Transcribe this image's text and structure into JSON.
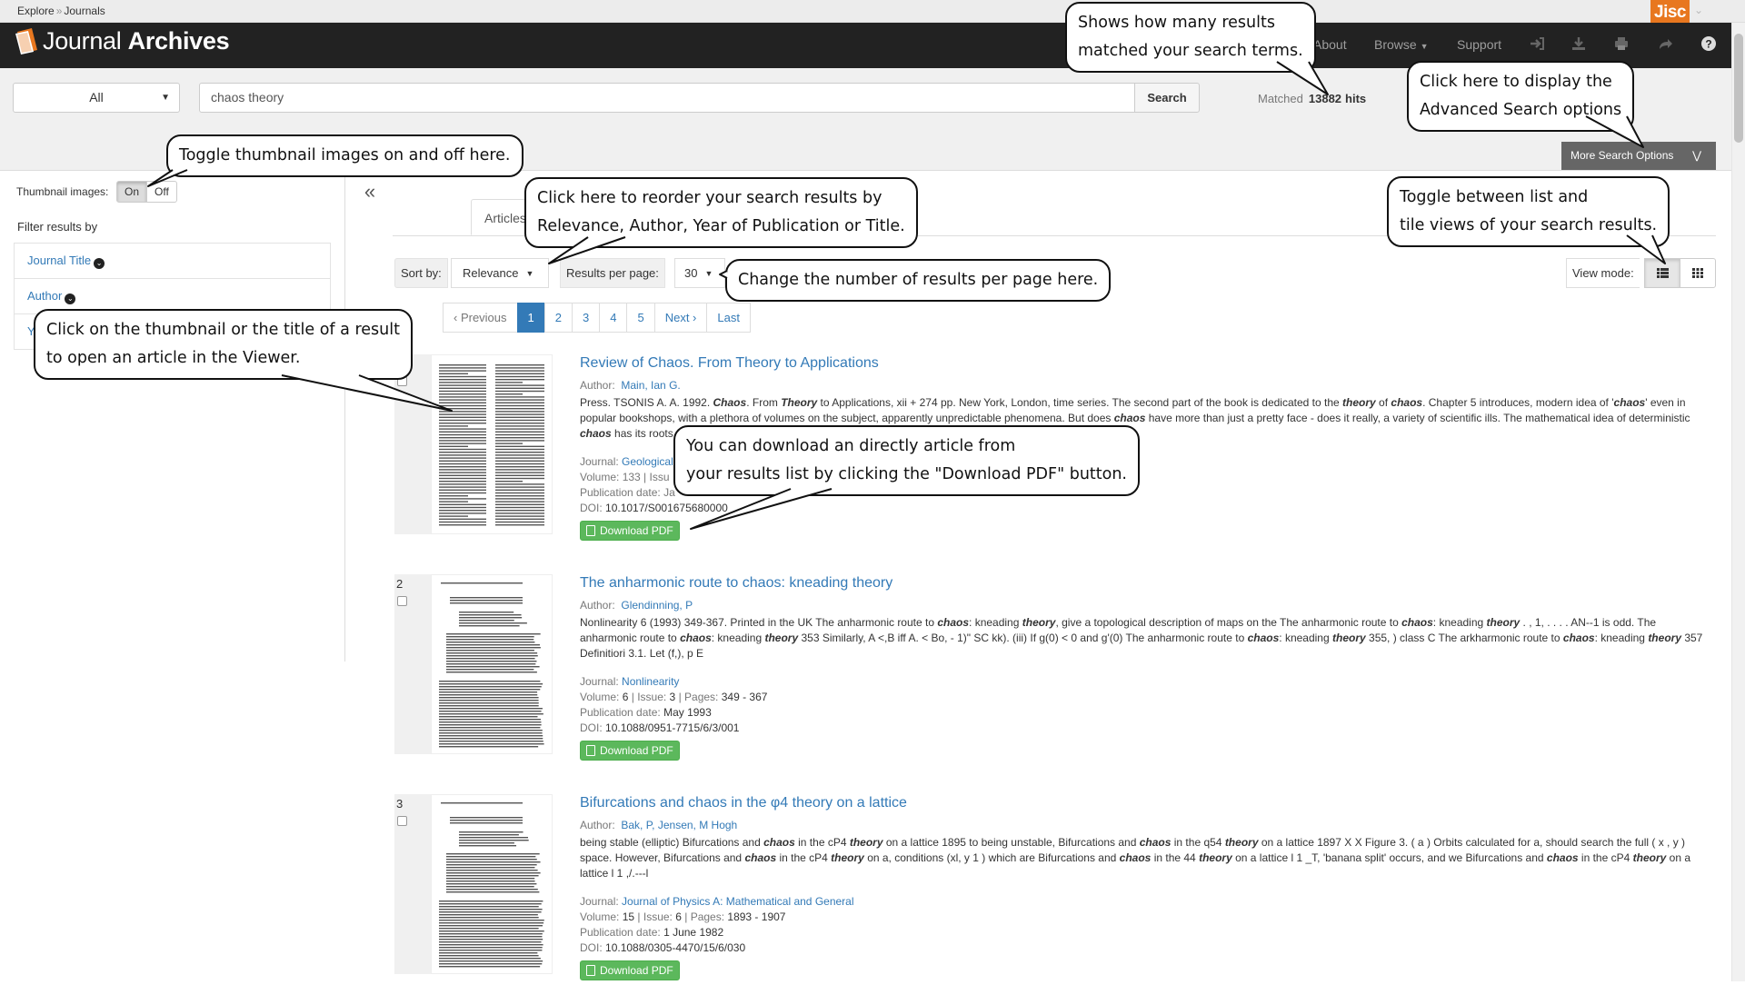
{
  "breadcrumb": {
    "explore": "Explore",
    "sep": "»",
    "journals": "Journals"
  },
  "brand": {
    "light": "Journal ",
    "bold": "Archives",
    "jisc": "Jisc"
  },
  "nav": {
    "about": "About",
    "browse": "Browse",
    "support": "Support"
  },
  "nav_icons": [
    "sign-in-icon",
    "download-icon",
    "print-icon",
    "share-icon",
    "help-icon"
  ],
  "search": {
    "scope": "All",
    "query": "chaos theory",
    "button": "Search",
    "matched_label": "Matched",
    "hit_count": "13882",
    "hits_label": "hits",
    "more_options": "More Search Options"
  },
  "sidebar": {
    "thumb_label": "Thumbnail images:",
    "on": "On",
    "off": "Off",
    "filter_title": "Filter results by",
    "facets": [
      "Journal Title",
      "Author",
      "Y"
    ]
  },
  "tabs": {
    "articles": "Articles"
  },
  "toolbar": {
    "sort_label": "Sort by:",
    "sort_value": "Relevance",
    "rpp_label": "Results per page:",
    "rpp_value": "30",
    "view_label": "View mode:"
  },
  "pager": [
    "‹ Previous",
    "1",
    "2",
    "3",
    "4",
    "5",
    "Next ›",
    "Last"
  ],
  "results": [
    {
      "num": "",
      "title": "Review of Chaos. From Theory to Applications",
      "author_label": "Author:",
      "author": "Main, Ian G.",
      "journal_label": "Journal:",
      "journal": "Geological",
      "volume_line": "Volume: 133 | Issu",
      "date_line": "Publication date: Ja",
      "doi_label": "DOI:",
      "doi": "10.1017/S001675680000",
      "download": "Download PDF"
    },
    {
      "num": "2",
      "title": "The anharmonic route to chaos: kneading theory",
      "author_label": "Author:",
      "author": "Glendinning, P",
      "journal_label": "Journal:",
      "journal": "Nonlinearity",
      "volume_label": "Volume:",
      "volume": "6",
      "issue_label": "Issue:",
      "issue": "3",
      "pages_label": "Pages:",
      "pages": "349 - 367",
      "date_label": "Publication date:",
      "date": "May 1993",
      "doi_label": "DOI:",
      "doi": "10.1088/0951-7715/6/3/001",
      "download": "Download PDF"
    },
    {
      "num": "3",
      "title": "Bifurcations and chaos in the φ4 theory on a lattice",
      "author_label": "Author:",
      "author": "Bak, P,  Jensen, M Hogh",
      "journal_label": "Journal:",
      "journal": "Journal of Physics A: Mathematical and General",
      "volume_label": "Volume:",
      "volume": "15",
      "issue_label": "Issue:",
      "issue": "6",
      "pages_label": "Pages:",
      "pages": "1893 - 1907",
      "date_label": "Publication date:",
      "date": "1 June 1982",
      "doi_label": "DOI:",
      "doi": "10.1088/0305-4470/15/6/030",
      "download": "Download PDF"
    }
  ],
  "callouts": {
    "hits": [
      "Shows how many results",
      "matched your search terms."
    ],
    "advanced": [
      "Click here to display the",
      "Advanced Search options"
    ],
    "thumbs": [
      "Toggle thumbnail images on and off here."
    ],
    "sort": [
      "Click here to reorder your search results by",
      "Relevance, Author, Year of Publication or Title."
    ],
    "view": [
      "Toggle between list and",
      "tile views of your search results."
    ],
    "rpp": [
      "Change the number of results per page here."
    ],
    "open": [
      "Click on the thumbnail or the title of a result",
      "to open an article in the Viewer."
    ],
    "download": [
      "You can download an directly article from",
      "your results list by clicking the \"Download PDF\" button."
    ]
  },
  "colors": {
    "navbar": "#222222",
    "link": "#337ab7",
    "download": "#5cb85c",
    "jisc": "#e8771f",
    "active_page": "#337ab7"
  }
}
